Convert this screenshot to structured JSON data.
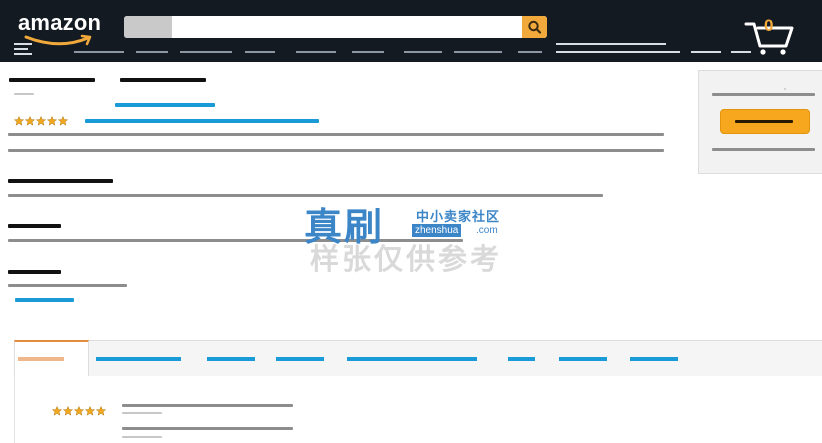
{
  "header": {
    "logo_text": "amazon",
    "cart_count": "0",
    "search": {
      "placeholder": ""
    },
    "colors": {
      "background": "#131a22",
      "accent": "#f2a93b"
    }
  },
  "product": {
    "rating_stars": 5
  },
  "buy_box": {
    "colors": {
      "button": "#f7a71e"
    }
  },
  "reviews": {
    "rating_stars": 5
  },
  "watermark": {
    "chinese_title": "真刷",
    "subtitle": "中小卖家社区",
    "domain": "zhenshua",
    "domain_suffix": ".com",
    "tagline": "样张仅供参考"
  },
  "icons": [
    "hamburger-icon",
    "search-icon",
    "cart-icon",
    "star-icon"
  ]
}
